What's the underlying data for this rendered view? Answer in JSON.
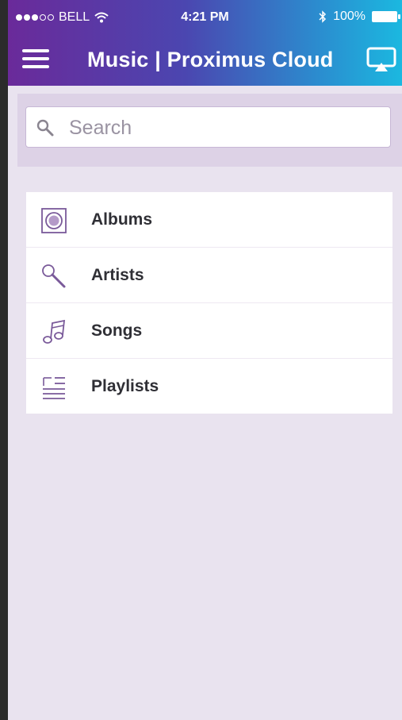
{
  "status_bar": {
    "carrier": "BELL",
    "time": "4:21 PM",
    "battery": "100%"
  },
  "header": {
    "title": "Music | Proximus Cloud"
  },
  "search": {
    "placeholder": "Search"
  },
  "menu": {
    "items": [
      {
        "label": "Albums",
        "icon": "album-icon"
      },
      {
        "label": "Artists",
        "icon": "microphone-icon"
      },
      {
        "label": "Songs",
        "icon": "music-note-icon"
      },
      {
        "label": "Playlists",
        "icon": "playlist-icon"
      }
    ]
  },
  "colors": {
    "header_gradient_start": "#6a2a9a",
    "header_gradient_end": "#1bb8e0",
    "background": "#e9e3ef",
    "icon": "#7a5a9a"
  }
}
